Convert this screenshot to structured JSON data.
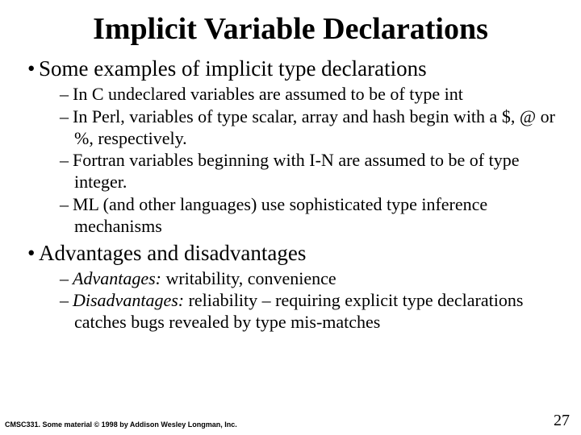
{
  "title": "Implicit Variable Declarations",
  "body": {
    "section1": {
      "heading": "Some examples of implicit type declarations",
      "items": [
        "In C undeclared variables are assumed to be of type int",
        "In Perl, variables of type scalar, array and hash begin with a $, @ or %, respectively.",
        "Fortran variables beginning with I-N are assumed to be of type integer.",
        "ML (and other languages) use sophisticated type inference mechanisms"
      ]
    },
    "section2": {
      "heading": "Advantages and disadvantages",
      "adv_label": "Advantages:",
      "adv_text": " writability, convenience",
      "dis_label": "Disadvantages:",
      "dis_text": " reliability – requiring explicit type declarations catches bugs revealed by type mis-matches"
    }
  },
  "footer": {
    "left": "CMSC331. Some material © 1998 by Addison Wesley Longman, Inc.",
    "right": "27"
  }
}
